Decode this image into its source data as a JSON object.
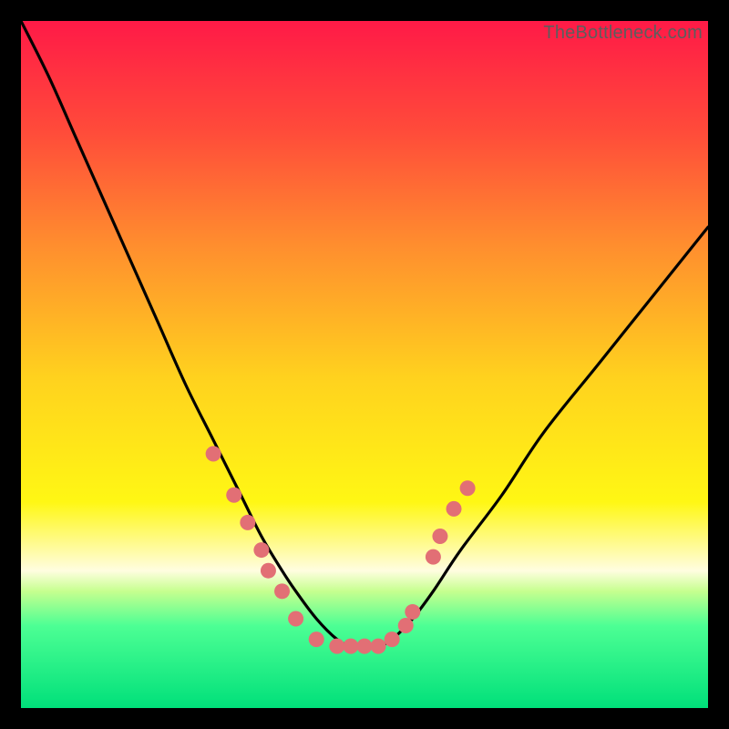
{
  "watermark": "TheBottleneck.com",
  "chart_data": {
    "type": "line",
    "title": "",
    "xlabel": "",
    "ylabel": "",
    "xlim": [
      0,
      100
    ],
    "ylim": [
      0,
      100
    ],
    "gradient_stops": [
      {
        "offset": 0.0,
        "color": "#ff1a47"
      },
      {
        "offset": 0.16,
        "color": "#ff4b3a"
      },
      {
        "offset": 0.33,
        "color": "#ff8f2e"
      },
      {
        "offset": 0.52,
        "color": "#ffd21e"
      },
      {
        "offset": 0.7,
        "color": "#fff714"
      },
      {
        "offset": 0.8,
        "color": "#fffde0"
      },
      {
        "offset": 0.83,
        "color": "#c6ff8f"
      },
      {
        "offset": 0.88,
        "color": "#4dff94"
      },
      {
        "offset": 1.0,
        "color": "#00e07a"
      }
    ],
    "series": [
      {
        "name": "bottleneck-curve",
        "x": [
          0,
          4,
          8,
          12,
          16,
          20,
          24,
          28,
          32,
          35,
          38,
          40,
          43,
          46,
          48,
          50,
          52,
          54,
          57,
          60,
          64,
          70,
          76,
          84,
          92,
          100
        ],
        "y": [
          100,
          92,
          83,
          74,
          65,
          56,
          47,
          39,
          31,
          25,
          20,
          17,
          13,
          10,
          9,
          9,
          9,
          10,
          13,
          17,
          23,
          31,
          40,
          50,
          60,
          70
        ]
      }
    ],
    "scatter_points": {
      "name": "marker-dots",
      "color": "#e26f75",
      "points": [
        {
          "x": 28,
          "y": 37
        },
        {
          "x": 31,
          "y": 31
        },
        {
          "x": 33,
          "y": 27
        },
        {
          "x": 35,
          "y": 23
        },
        {
          "x": 36,
          "y": 20
        },
        {
          "x": 38,
          "y": 17
        },
        {
          "x": 40,
          "y": 13
        },
        {
          "x": 43,
          "y": 10
        },
        {
          "x": 46,
          "y": 9
        },
        {
          "x": 48,
          "y": 9
        },
        {
          "x": 50,
          "y": 9
        },
        {
          "x": 52,
          "y": 9
        },
        {
          "x": 54,
          "y": 10
        },
        {
          "x": 56,
          "y": 12
        },
        {
          "x": 57,
          "y": 14
        },
        {
          "x": 60,
          "y": 22
        },
        {
          "x": 61,
          "y": 25
        },
        {
          "x": 63,
          "y": 29
        },
        {
          "x": 65,
          "y": 32
        }
      ]
    }
  }
}
